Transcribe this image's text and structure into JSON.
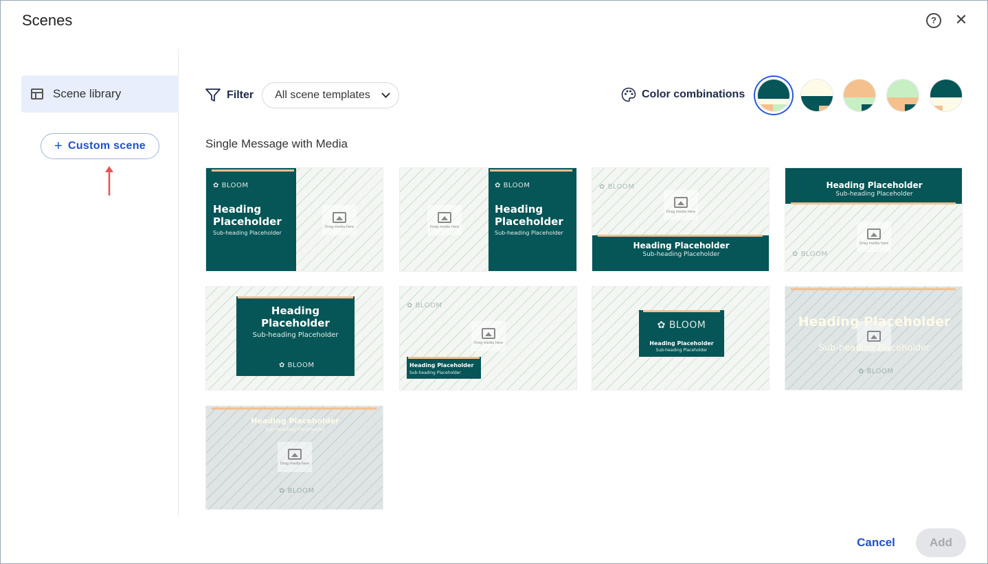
{
  "dialog": {
    "title": "Scenes"
  },
  "sidebar": {
    "library_label": "Scene library",
    "custom_scene_label": "Custom scene"
  },
  "toolbar": {
    "filter_label": "Filter",
    "filter_value": "All scene templates",
    "colors_label": "Color combinations"
  },
  "swatches": [
    {
      "selected": true,
      "colors": [
        "#065557",
        "#fdfbe8",
        "#f4c08e"
      ]
    },
    {
      "selected": false,
      "colors": [
        "#fdfbe8",
        "#065557",
        "#f4c08e"
      ]
    },
    {
      "selected": false,
      "colors": [
        "#f4c08e",
        "#c8eec4",
        "#065557"
      ]
    },
    {
      "selected": false,
      "colors": [
        "#c8eec4",
        "#f4c08e",
        "#065557"
      ]
    },
    {
      "selected": false,
      "colors": [
        "#065557",
        "#fdfbe8",
        "#f4c08e"
      ]
    }
  ],
  "section": {
    "title": "Single Message with Media"
  },
  "template_text": {
    "heading": "Heading Placeholder",
    "heading_line1": "Heading",
    "heading_line2": "Placeholder",
    "subheading": "Sub-heading Placeholder",
    "brand": "BLOOM",
    "drag_media": "Drag media here"
  },
  "footer": {
    "cancel_label": "Cancel",
    "add_label": "Add"
  }
}
